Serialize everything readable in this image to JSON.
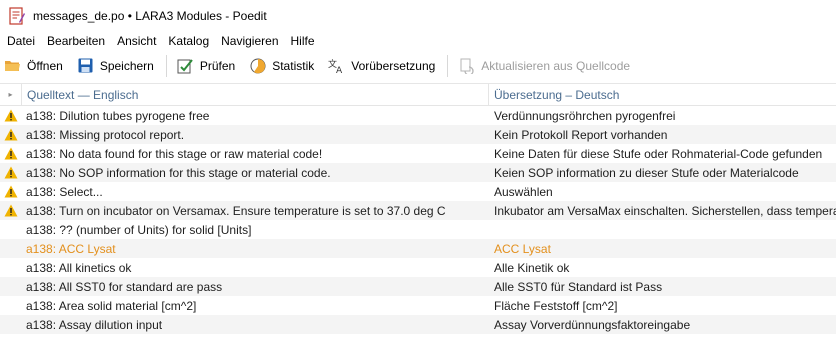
{
  "window": {
    "title": "messages_de.po • LARA3 Modules - Poedit"
  },
  "menu": [
    "Datei",
    "Bearbeiten",
    "Ansicht",
    "Katalog",
    "Navigieren",
    "Hilfe"
  ],
  "toolbar": {
    "open": "Öffnen",
    "save": "Speichern",
    "validate": "Prüfen",
    "statistics": "Statistik",
    "pretranslate": "Vorübersetzung",
    "update_from_source": "Aktualisieren aus Quellcode"
  },
  "columns": {
    "source": "Quelltext — Englisch",
    "translation": "Übersetzung – Deutsch"
  },
  "colors": {
    "warning": "#f0b300",
    "fuzzy": "#e3901d",
    "header_text": "#4b6c8f"
  },
  "rows": [
    {
      "source": "a138: Dilution tubes pyrogene free",
      "translation": "Verdünnungsröhrchen pyrogenfrei",
      "status": "warning"
    },
    {
      "source": "a138: Missing protocol report.",
      "translation": "Kein  Protokoll Report vorhanden",
      "status": "warning"
    },
    {
      "source": "a138: No data found for this stage or raw material code!",
      "translation": "Keine Daten für diese Stufe oder Rohmaterial-Code gefunden",
      "status": "warning"
    },
    {
      "source": "a138: No SOP information for this stage or material code.",
      "translation": "Keien SOP information zu dieser Stufe oder Materialcode",
      "status": "warning"
    },
    {
      "source": "a138: Select...",
      "translation": "Auswählen",
      "status": "warning"
    },
    {
      "source": "a138: Turn on incubator on Versamax. Ensure temperature is set to 37.0 deg C",
      "translation": "Inkubator am VersaMax einschalten. Sicherstellen, dass temperatu",
      "status": "warning"
    },
    {
      "source": "a138: ?? (number of Units) for solid [Units]",
      "translation": "",
      "status": "untranslated"
    },
    {
      "source": "a138: ACC Lysat",
      "translation": "ACC Lysat",
      "status": "fuzzy"
    },
    {
      "source": "a138: All kinetics ok",
      "translation": "Alle Kinetik ok",
      "status": "ok"
    },
    {
      "source": "a138: All SST0 for standard are pass",
      "translation": "Alle SST0 für Standard ist Pass",
      "status": "ok"
    },
    {
      "source": "a138: Area solid material [cm^2]",
      "translation": "Fläche Feststoff [cm^2]",
      "status": "ok"
    },
    {
      "source": "a138: Assay dilution input",
      "translation": "Assay Vorverdünnungsfaktoreingabe",
      "status": "ok"
    }
  ]
}
